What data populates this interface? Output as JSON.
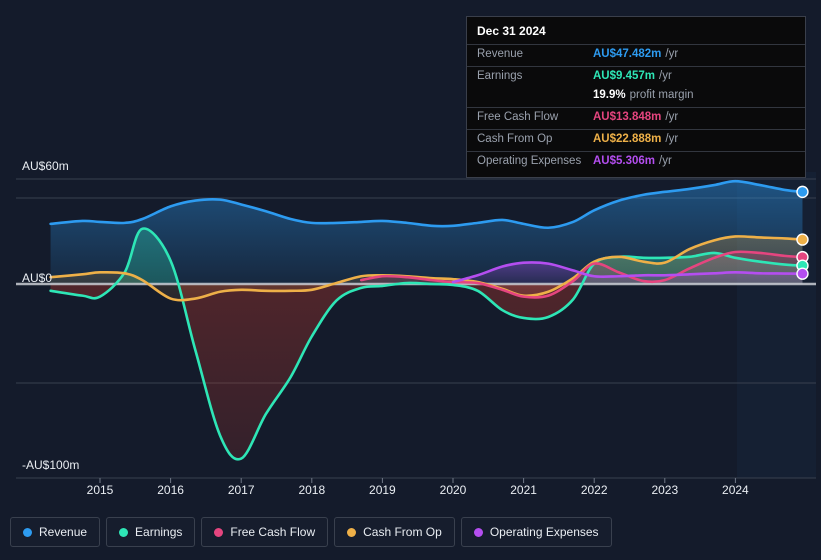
{
  "tooltip": {
    "date": "Dec 31 2024",
    "rows": [
      {
        "key": "Revenue",
        "value": "AU$47.482m",
        "unit": "/yr",
        "color": "#2d9bf0"
      },
      {
        "key": "Earnings",
        "value": "AU$9.457m",
        "unit": "/yr",
        "color": "#2ee6b6"
      },
      {
        "key": "Free Cash Flow",
        "value": "AU$13.848m",
        "unit": "/yr",
        "color": "#e5457f"
      },
      {
        "key": "Cash From Op",
        "value": "AU$22.888m",
        "unit": "/yr",
        "color": "#eeb048"
      },
      {
        "key": "Operating Expenses",
        "value": "AU$5.306m",
        "unit": "/yr",
        "color": "#b44ef0"
      }
    ],
    "profit_margin": {
      "value": "19.9%",
      "label": "profit margin"
    }
  },
  "legend": [
    {
      "label": "Revenue",
      "color": "#2d9bf0"
    },
    {
      "label": "Earnings",
      "color": "#2ee6b6"
    },
    {
      "label": "Free Cash Flow",
      "color": "#e5457f"
    },
    {
      "label": "Cash From Op",
      "color": "#eeb048"
    },
    {
      "label": "Operating Expenses",
      "color": "#b44ef0"
    }
  ],
  "chart_data": {
    "type": "area",
    "title": "",
    "xlabel": "",
    "ylabel": "",
    "currency": "AU$",
    "unit": "m",
    "grid": true,
    "legend_position": "bottom",
    "ylim": [
      -100,
      60
    ],
    "xlim": [
      2014.3,
      2024.95
    ],
    "y_ticks": [
      60,
      0,
      -100
    ],
    "y_tick_labels": [
      "AU$60m",
      "AU$0",
      "-AU$100m"
    ],
    "x_ticks": [
      2015,
      2016,
      2017,
      2018,
      2019,
      2020,
      2021,
      2022,
      2023,
      2024
    ],
    "x_tick_labels": [
      "2015",
      "2016",
      "2017",
      "2018",
      "2019",
      "2020",
      "2021",
      "2022",
      "2023",
      "2024"
    ],
    "x": [
      2014.3,
      2014.75,
      2015.0,
      2015.35,
      2015.6,
      2016.0,
      2016.35,
      2016.7,
      2017.0,
      2017.35,
      2017.7,
      2018.0,
      2018.35,
      2018.7,
      2019.0,
      2019.35,
      2019.7,
      2020.0,
      2020.35,
      2020.7,
      2021.0,
      2021.35,
      2021.7,
      2022.0,
      2022.35,
      2022.7,
      2023.0,
      2023.35,
      2023.7,
      2024.0,
      2024.35,
      2024.7,
      2024.95
    ],
    "series": [
      {
        "name": "Revenue",
        "color": "#2d9bf0",
        "values": [
          31.0,
          32.5,
          32.0,
          31.5,
          33.5,
          40.0,
          43.0,
          43.5,
          41.0,
          37.5,
          33.5,
          31.5,
          31.5,
          32.0,
          32.5,
          31.5,
          30.0,
          30.0,
          31.5,
          33.0,
          31.0,
          29.0,
          32.0,
          38.0,
          43.0,
          46.0,
          47.5,
          49.0,
          51.0,
          53.0,
          51.0,
          48.5,
          47.482
        ]
      },
      {
        "name": "Earnings",
        "color": "#2ee6b6",
        "values": [
          -3.5,
          -6.0,
          -6.5,
          6.0,
          28.5,
          12.0,
          -34.0,
          -78.0,
          -90.0,
          -67.0,
          -48.0,
          -27.0,
          -8.5,
          -2.0,
          -1.0,
          0.5,
          0.0,
          -0.5,
          -3.5,
          -13.5,
          -17.5,
          -17.0,
          -8.0,
          10.5,
          14.0,
          13.5,
          13.5,
          14.0,
          16.0,
          13.5,
          11.5,
          10.0,
          9.457
        ]
      },
      {
        "name": "Free Cash Flow",
        "color": "#e5457f",
        "values": [
          null,
          null,
          null,
          null,
          null,
          null,
          null,
          null,
          null,
          null,
          null,
          null,
          null,
          2.0,
          4.0,
          3.5,
          2.0,
          1.0,
          0.5,
          -3.0,
          -6.5,
          -6.0,
          1.5,
          10.5,
          6.0,
          1.5,
          2.0,
          8.0,
          13.5,
          16.5,
          16.0,
          14.5,
          13.848
        ]
      },
      {
        "name": "Cash From Op",
        "color": "#eeb048",
        "values": [
          3.5,
          5.0,
          6.0,
          5.5,
          2.0,
          -7.5,
          -7.5,
          -4.0,
          -3.0,
          -3.5,
          -3.5,
          -3.0,
          0.5,
          4.0,
          4.5,
          4.0,
          3.0,
          2.5,
          1.0,
          -2.5,
          -6.0,
          -4.0,
          3.0,
          11.5,
          14.0,
          11.5,
          11.0,
          18.0,
          22.5,
          24.5,
          24.0,
          23.5,
          22.888
        ]
      },
      {
        "name": "Operating Expenses",
        "color": "#b44ef0",
        "values": [
          null,
          null,
          null,
          null,
          null,
          null,
          null,
          null,
          null,
          null,
          null,
          null,
          null,
          null,
          null,
          null,
          null,
          1.0,
          4.5,
          9.0,
          11.0,
          10.5,
          7.0,
          4.0,
          4.0,
          4.5,
          4.5,
          5.0,
          5.5,
          6.0,
          5.5,
          5.4,
          5.306
        ]
      }
    ]
  }
}
